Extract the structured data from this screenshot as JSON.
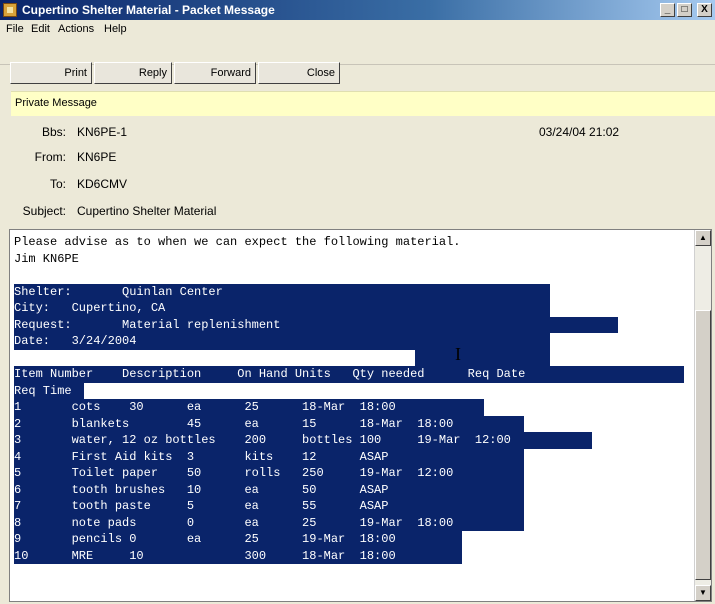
{
  "window": {
    "title": "Cupertino Shelter Material - Packet Message",
    "controls": {
      "minimize": "_",
      "maximize": "□",
      "close": "X"
    }
  },
  "menu": [
    "File",
    "Edit",
    "Actions",
    "Help"
  ],
  "toolbar": {
    "print": "Print",
    "reply": "Reply",
    "forward": "Forward",
    "close": "Close"
  },
  "header": {
    "private_label": "Private Message",
    "bbs_label": "Bbs:",
    "bbs_value": "KN6PE-1",
    "date_value": "03/24/04 21:02",
    "from_label": "From:",
    "from_value": "KN6PE",
    "to_label": "To:",
    "to_value": "KD6CMV",
    "subject_label": "Subject:",
    "subject_value": "Cupertino Shelter Material"
  },
  "message": {
    "intro": [
      "Please advise as to when we can expect the following material.",
      "Jim KN6PE",
      ""
    ],
    "selected": [
      {
        "text": "Shelter:       Quinlan Center",
        "width": 536
      },
      {
        "text": "City:   Cupertino, CA",
        "width": 536
      },
      {
        "text": "Request:       Material replenishment",
        "width": 604
      },
      {
        "text": "Date:   3/24/2004",
        "width": 536
      },
      {
        "text": "",
        "width": 536,
        "offset": 401
      },
      {
        "text": "Item Number    Description     On Hand Units   Qty needed      Req Date",
        "width": 670
      },
      {
        "text": "Req Time",
        "width": 70
      },
      {
        "text": "1       cots    30      ea      25      18-Mar  18:00",
        "width": 470
      },
      {
        "text": "2       blankets        45      ea      15      18-Mar  18:00",
        "width": 510
      },
      {
        "text": "3       water, 12 oz bottles    200     bottles 100     19-Mar  12:00",
        "width": 578
      },
      {
        "text": "4       First Aid kits  3       kits    12      ASAP",
        "width": 510
      },
      {
        "text": "5       Toilet paper    50      rolls   250     19-Mar  12:00",
        "width": 510
      },
      {
        "text": "6       tooth brushes   10      ea      50      ASAP",
        "width": 510
      },
      {
        "text": "7       tooth paste     5       ea      55      ASAP",
        "width": 510
      },
      {
        "text": "8       note pads       0       ea      25      19-Mar  18:00",
        "width": 510
      },
      {
        "text": "9       pencils 0       ea      25      19-Mar  18:00",
        "width": 448
      },
      {
        "text": "10      MRE     10              300     18-Mar  18:00",
        "width": 448
      }
    ]
  },
  "cursor_glyph": "I",
  "colors": {
    "selection": "#0a246a",
    "private_bar": "#ffffc6"
  }
}
